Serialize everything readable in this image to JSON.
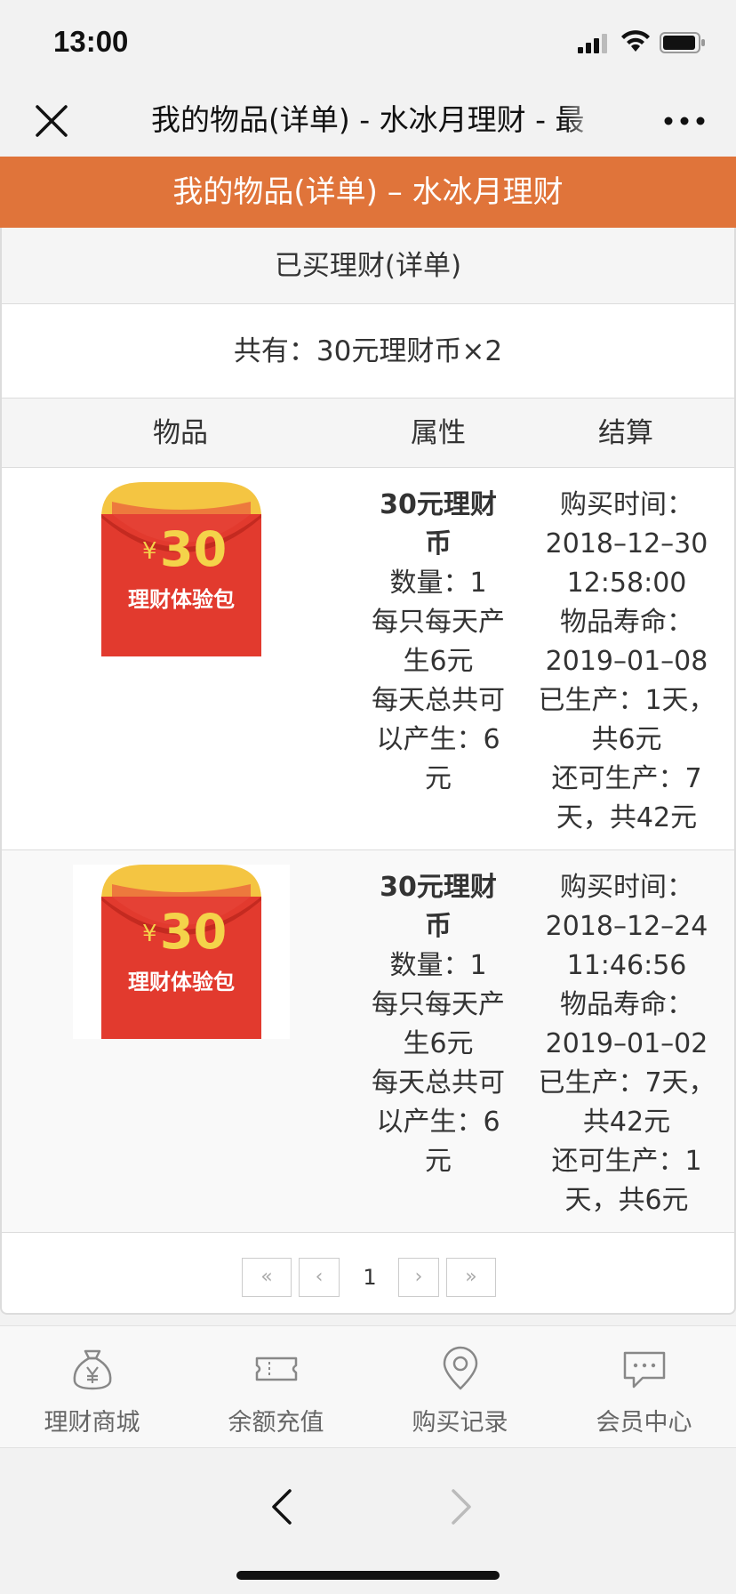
{
  "status_bar": {
    "time": "13:00"
  },
  "nav": {
    "title": "我的物品(详单) - 水冰月理财 - 最"
  },
  "header": {
    "title": "我的物品(详单) – 水冰月理财"
  },
  "panel": {
    "title": "已买理财(详单)",
    "summary": "共有：30元理财币×2",
    "columns": [
      "物品",
      "属性",
      "结算"
    ]
  },
  "coupon_image": {
    "symbol": "¥",
    "amount": "30",
    "caption": "理财体验包"
  },
  "rows": [
    {
      "name": "30元理财币",
      "qty": "数量：1",
      "per_day": "每只每天产生6元",
      "daily_total": "每天总共可以产生：6元",
      "buy_label": "购买时间：",
      "buy_time": "2018–12–30 12:58:00",
      "life_label": "物品寿命：",
      "life": "2019–01–08",
      "produced": "已生产：1天，共6元",
      "remaining": "还可生产：7天，共42元"
    },
    {
      "name": "30元理财币",
      "qty": "数量：1",
      "per_day": "每只每天产生6元",
      "daily_total": "每天总共可以产生：6元",
      "buy_label": "购买时间：",
      "buy_time": "2018–12–24 11:46:56",
      "life_label": "物品寿命：",
      "life": "2019–01–02",
      "produced": "已生产：7天，共42元",
      "remaining": "还可生产：1天，共6元"
    }
  ],
  "pagination": {
    "first": "«",
    "prev": "‹",
    "current": "1",
    "next": "›",
    "last": "»"
  },
  "tabs": [
    {
      "label": "理财商城",
      "icon": "money-bag-icon"
    },
    {
      "label": "余额充值",
      "icon": "ticket-icon"
    },
    {
      "label": "购买记录",
      "icon": "location-pin-icon"
    },
    {
      "label": "会员中心",
      "icon": "chat-bubble-icon"
    }
  ],
  "colors": {
    "header_orange": "#e0743a",
    "coupon_red": "#e23a2e",
    "coupon_yellow": "#f4c542"
  }
}
